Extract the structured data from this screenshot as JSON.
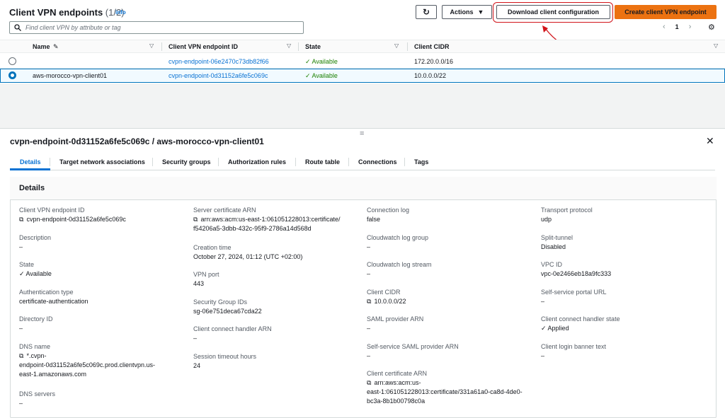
{
  "header": {
    "title": "Client VPN endpoints",
    "count": "(1/2)",
    "info": "info",
    "refresh_icon": "refresh-icon",
    "actions_label": "Actions",
    "download_label": "Download client configuration",
    "create_label": "Create client VPN endpoint"
  },
  "search": {
    "placeholder": "Find client VPN by attribute or tag"
  },
  "pagination": {
    "prev": "‹",
    "page": "1",
    "next": "›"
  },
  "table": {
    "columns": [
      "Name",
      "Client VPN endpoint ID",
      "State",
      "Client CIDR"
    ],
    "rows": [
      {
        "name": "",
        "id": "cvpn-endpoint-06e2470c73db82f66",
        "state": "Available",
        "cidr": "172.20.0.0/16"
      },
      {
        "name": "aws-morocco-vpn-client01",
        "id": "cvpn-endpoint-0d31152a6fe5c069c",
        "state": "Available",
        "cidr": "10.0.0.0/22"
      }
    ]
  },
  "detail": {
    "title": "cvpn-endpoint-0d31152a6fe5c069c / aws-morocco-vpn-client01",
    "tabs": [
      "Details",
      "Target network associations",
      "Security groups",
      "Authorization rules",
      "Route table",
      "Connections",
      "Tags"
    ],
    "card_title": "Details",
    "fields": {
      "endpoint_id": {
        "label": "Client VPN endpoint ID",
        "value": "cvpn-endpoint-0d31152a6fe5c069c"
      },
      "description": {
        "label": "Description",
        "value": "–"
      },
      "state": {
        "label": "State",
        "value": "Available"
      },
      "auth_type": {
        "label": "Authentication type",
        "value": "certificate-authentication"
      },
      "directory_id": {
        "label": "Directory ID",
        "value": "–"
      },
      "dns_name": {
        "label": "DNS name",
        "value_1": "*.cvpn-",
        "value_2": "endpoint-0d31152a6fe5c069c.prod.clientvpn.us-",
        "value_3": "east-1.amazonaws.com"
      },
      "dns_servers": {
        "label": "DNS servers",
        "value": "–"
      },
      "server_cert": {
        "label": "Server certificate ARN",
        "value_1": "arn:aws:acm:us-east-1:061051228013:certificate/",
        "value_2": "f54206a5-3dbb-432c-95f9-2786a14d568d"
      },
      "creation_time": {
        "label": "Creation time",
        "value": "October 27, 2024, 01:12 (UTC +02:00)"
      },
      "vpn_port": {
        "label": "VPN port",
        "value": "443"
      },
      "sg_ids": {
        "label": "Security Group IDs",
        "value": "sg-06e751deca67cda22"
      },
      "handler_arn": {
        "label": "Client connect handler ARN",
        "value": "–"
      },
      "session_timeout": {
        "label": "Session timeout hours",
        "value": "24"
      },
      "conn_log": {
        "label": "Connection log",
        "value": "false"
      },
      "cw_group": {
        "label": "Cloudwatch log group",
        "value": "–"
      },
      "cw_stream": {
        "label": "Cloudwatch log stream",
        "value": "–"
      },
      "client_cidr": {
        "label": "Client CIDR",
        "value": "10.0.0.0/22"
      },
      "saml_arn": {
        "label": "SAML provider ARN",
        "value": "–"
      },
      "ss_saml_arn": {
        "label": "Self-service SAML provider ARN",
        "value": "–"
      },
      "client_cert": {
        "label": "Client certificate ARN",
        "value_1": "arn:aws:acm:us-",
        "value_2": "east-1:061051228013:certificate/331a61a0-ca8d-4de0-",
        "value_3": "bc3a-8b1b00798c0a"
      },
      "transport": {
        "label": "Transport protocol",
        "value": "udp"
      },
      "split_tunnel": {
        "label": "Split-tunnel",
        "value": "Disabled"
      },
      "vpc_id": {
        "label": "VPC ID",
        "value": "vpc-0e2466eb18a9fc333"
      },
      "ss_portal": {
        "label": "Self-service portal URL",
        "value": "–"
      },
      "handler_state": {
        "label": "Client connect handler state",
        "value": "Applied"
      },
      "banner": {
        "label": "Client login banner text",
        "value": "–"
      }
    }
  },
  "colors": {
    "accent": "#0972d3",
    "primary_button": "#ec7211",
    "success": "#1d8102",
    "annotation": "#d1141a"
  }
}
